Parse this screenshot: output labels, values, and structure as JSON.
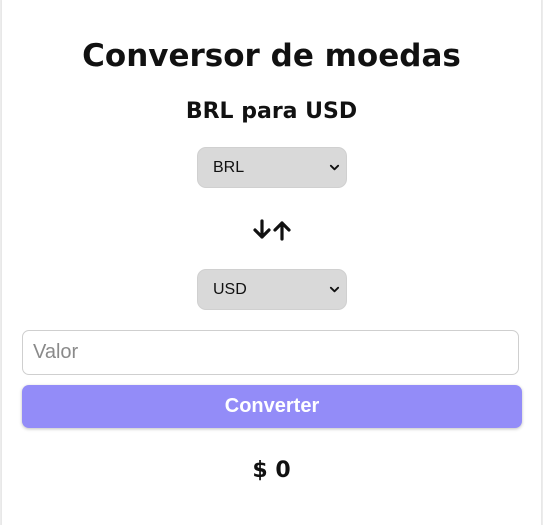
{
  "header": {
    "title": "Conversor de moedas",
    "subtitle": "BRL para USD"
  },
  "from_currency": {
    "selected": "BRL",
    "icon": "chevron-down-icon"
  },
  "swap": {
    "icon": "swap-arrows-icon"
  },
  "to_currency": {
    "selected": "USD",
    "icon": "chevron-down-icon"
  },
  "amount": {
    "value": "",
    "placeholder": "Valor"
  },
  "convert": {
    "label": "Converter"
  },
  "result": {
    "text": "$ 0"
  },
  "colors": {
    "button": "#938cf8",
    "select_bg": "#d9d9d9",
    "page_bg": "#ececec",
    "card_bg": "#ffffff"
  }
}
